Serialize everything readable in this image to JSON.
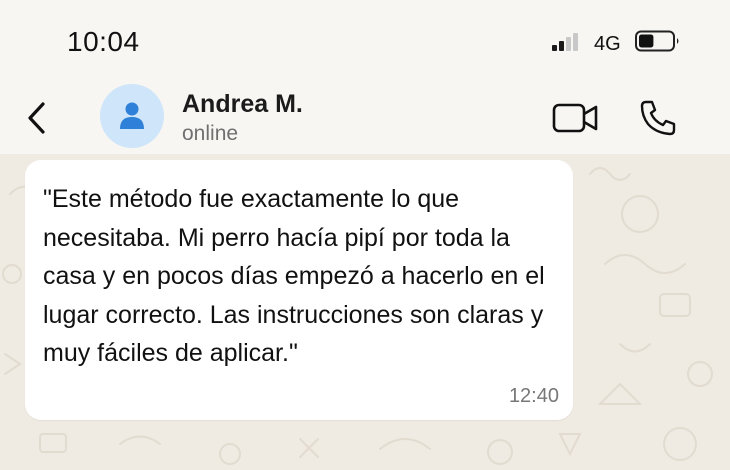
{
  "status_bar": {
    "time": "10:04",
    "network": "4G",
    "signal_icon": "cellular-signal-icon",
    "battery_icon": "battery-icon",
    "battery_level": 0.45
  },
  "header": {
    "back_icon": "chevron-left-icon",
    "avatar_icon": "person-icon",
    "contact_name": "Andrea M.",
    "presence": "online",
    "video_icon": "video-camera-icon",
    "call_icon": "phone-icon"
  },
  "messages": [
    {
      "text": "\"Este método fue exactamente lo que necesitaba. Mi perro hacía pipí por toda la casa y en pocos días empezó a hacerlo en el lugar correcto. Las instrucciones son claras y muy fáciles de aplicar.\"",
      "time": "12:40",
      "direction": "incoming"
    }
  ],
  "colors": {
    "accent": "#2f80d8",
    "avatar_bg": "#cfe5fa",
    "chat_bg": "#efeae2",
    "bubble": "#ffffff"
  }
}
